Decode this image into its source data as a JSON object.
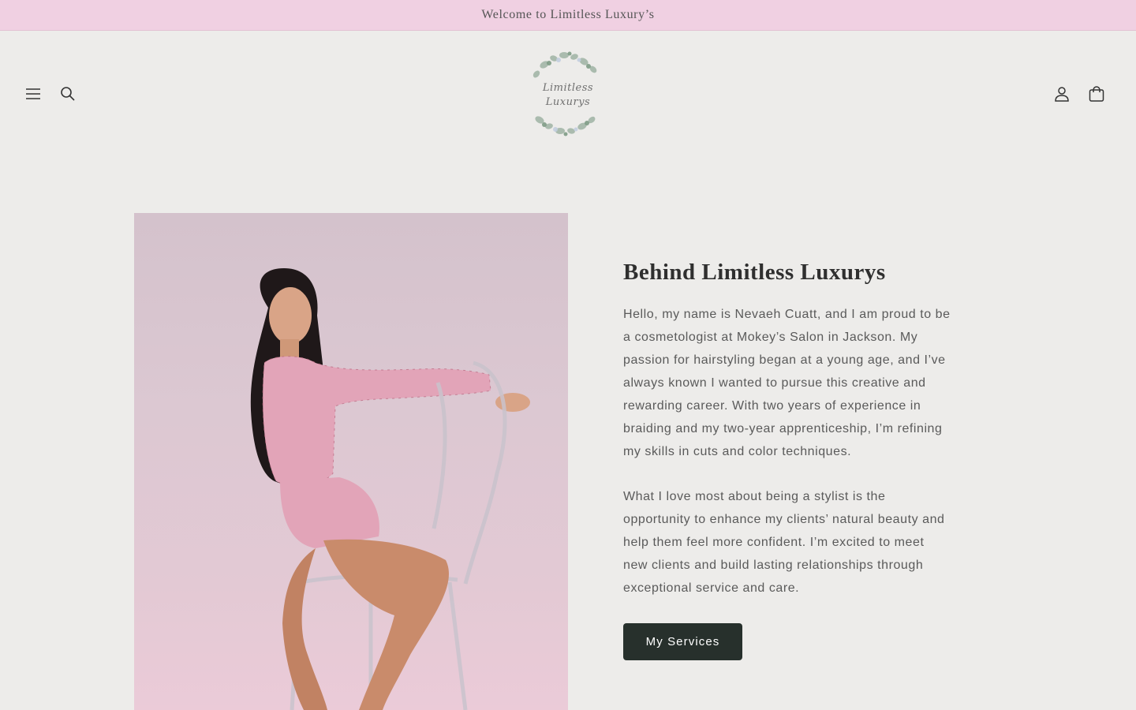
{
  "announcement": {
    "text": "Welcome to Limitless Luxury’s"
  },
  "header": {
    "logo": {
      "line1": "Limitless",
      "line2": "Luxurys"
    },
    "icons": {
      "menu": "hamburger-menu-icon",
      "search": "search-icon",
      "account": "account-icon",
      "cart": "cart-icon"
    }
  },
  "about": {
    "heading": "Behind Limitless Luxurys",
    "paragraph1": "Hello, my name is Nevaeh Cuatt, and I am proud to be a cosmetologist at Mokey’s Salon in Jackson. My passion for hairstyling began at a young age, and I’ve always known I wanted to pursue this creative and rewarding career. With two years of experience in braiding and my two-year apprenticeship, I’m refining my skills in cuts and color techniques.",
    "paragraph2": "What I love most about being a stylist is the opportunity to enhance my clients’ natural beauty and help them feel more confident. I’m excited to meet new clients and build lasting relationships through exceptional service and care.",
    "button_label": "My Services"
  },
  "colors": {
    "announcement_bg": "#f0d0e2",
    "page_bg": "#edecea",
    "button_bg": "#27302c"
  }
}
